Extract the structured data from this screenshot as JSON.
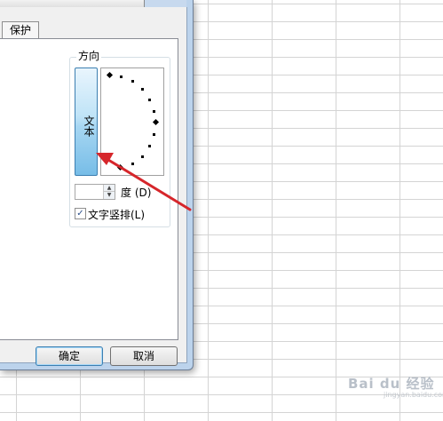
{
  "dialog": {
    "tab_label": "保护",
    "orientation_title": "方向",
    "text_button_label": "文本",
    "degree_value": "",
    "degree_label": "度 (D)",
    "vertical_text_label": "文字竖排(L)",
    "vertical_text_checked": true,
    "ok_label": "确定",
    "cancel_label": "取消"
  },
  "watermark": {
    "text": "Bai du 经验",
    "sub": "jingyan.baidu.com"
  },
  "colors": {
    "arrow": "#d6262b",
    "text_button": "#a6d6f2"
  }
}
